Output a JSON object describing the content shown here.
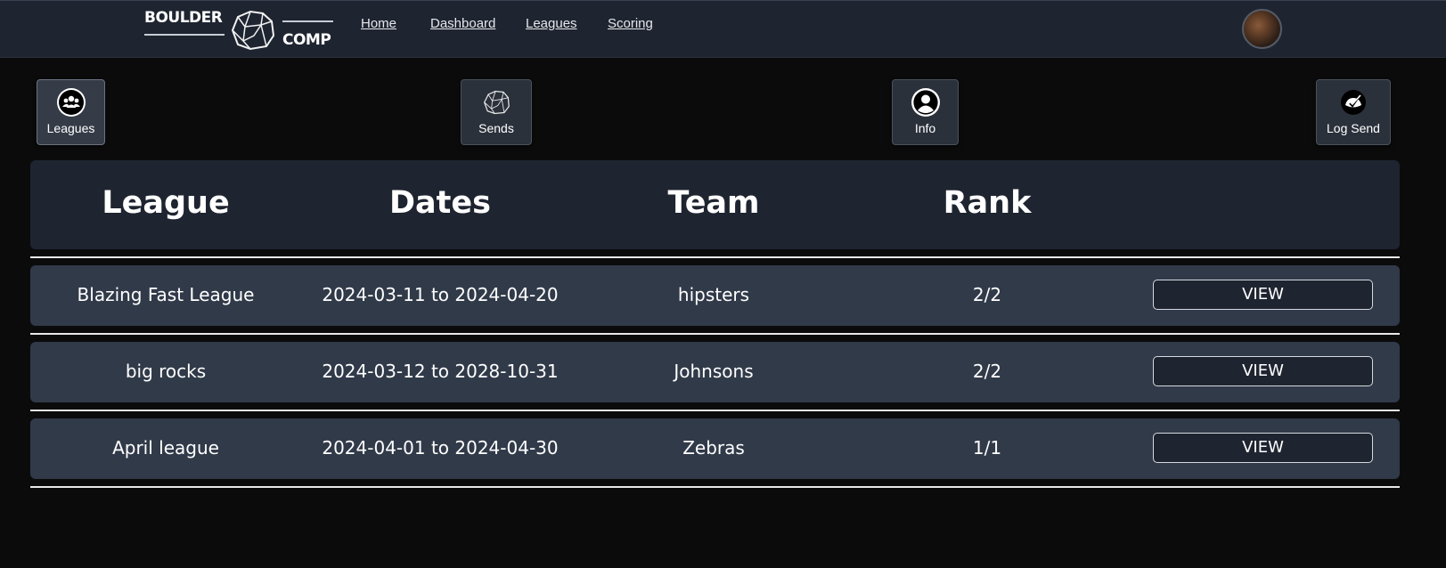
{
  "logo": {
    "word1": "BOULDER",
    "word2": "COMP"
  },
  "nav": {
    "links": [
      "Home",
      "Dashboard",
      "Leagues",
      "Scoring"
    ]
  },
  "actions": {
    "leagues": "Leagues",
    "sends": "Sends",
    "info": "Info",
    "log_send": "Log Send"
  },
  "table": {
    "headers": [
      "League",
      "Dates",
      "Team",
      "Rank"
    ],
    "rows": [
      {
        "league": "Blazing Fast League",
        "dates": "2024-03-11 to 2024-04-20",
        "team": "hipsters",
        "rank": "2/2",
        "action": "VIEW"
      },
      {
        "league": "big rocks",
        "dates": "2024-03-12 to 2028-10-31",
        "team": "Johnsons",
        "rank": "2/2",
        "action": "VIEW"
      },
      {
        "league": "April league",
        "dates": "2024-04-01 to 2024-04-30",
        "team": "Zebras",
        "rank": "1/1",
        "action": "VIEW"
      }
    ]
  },
  "colors": {
    "background": "#0b0b0c",
    "nav_bg": "#1e2430",
    "row_bg": "#313a49",
    "button_bg": "#2b313b"
  },
  "icons": {
    "leagues": "group-icon",
    "sends": "boulder-icon",
    "info": "user-icon",
    "log_send": "check-badge-icon",
    "logo": "rock-icon"
  }
}
